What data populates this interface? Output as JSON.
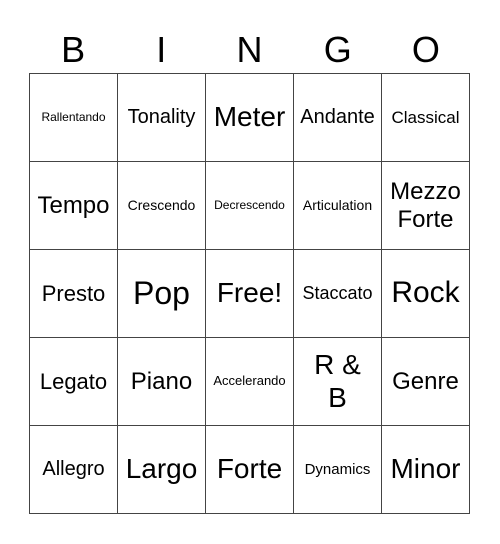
{
  "header": {
    "letters": [
      "B",
      "I",
      "N",
      "G",
      "O"
    ]
  },
  "cells": [
    [
      "Rallentando",
      "Tonality",
      "Meter",
      "Andante",
      "Classical"
    ],
    [
      "Tempo",
      "Crescendo",
      "Decrescendo",
      "Articulation",
      "Mezzo Forte"
    ],
    [
      "Presto",
      "Pop",
      "Free!",
      "Staccato",
      "Rock"
    ],
    [
      "Legato",
      "Piano",
      "Accelerando",
      "R & B",
      "Genre"
    ],
    [
      "Allegro",
      "Largo",
      "Forte",
      "Dynamics",
      "Minor"
    ]
  ]
}
